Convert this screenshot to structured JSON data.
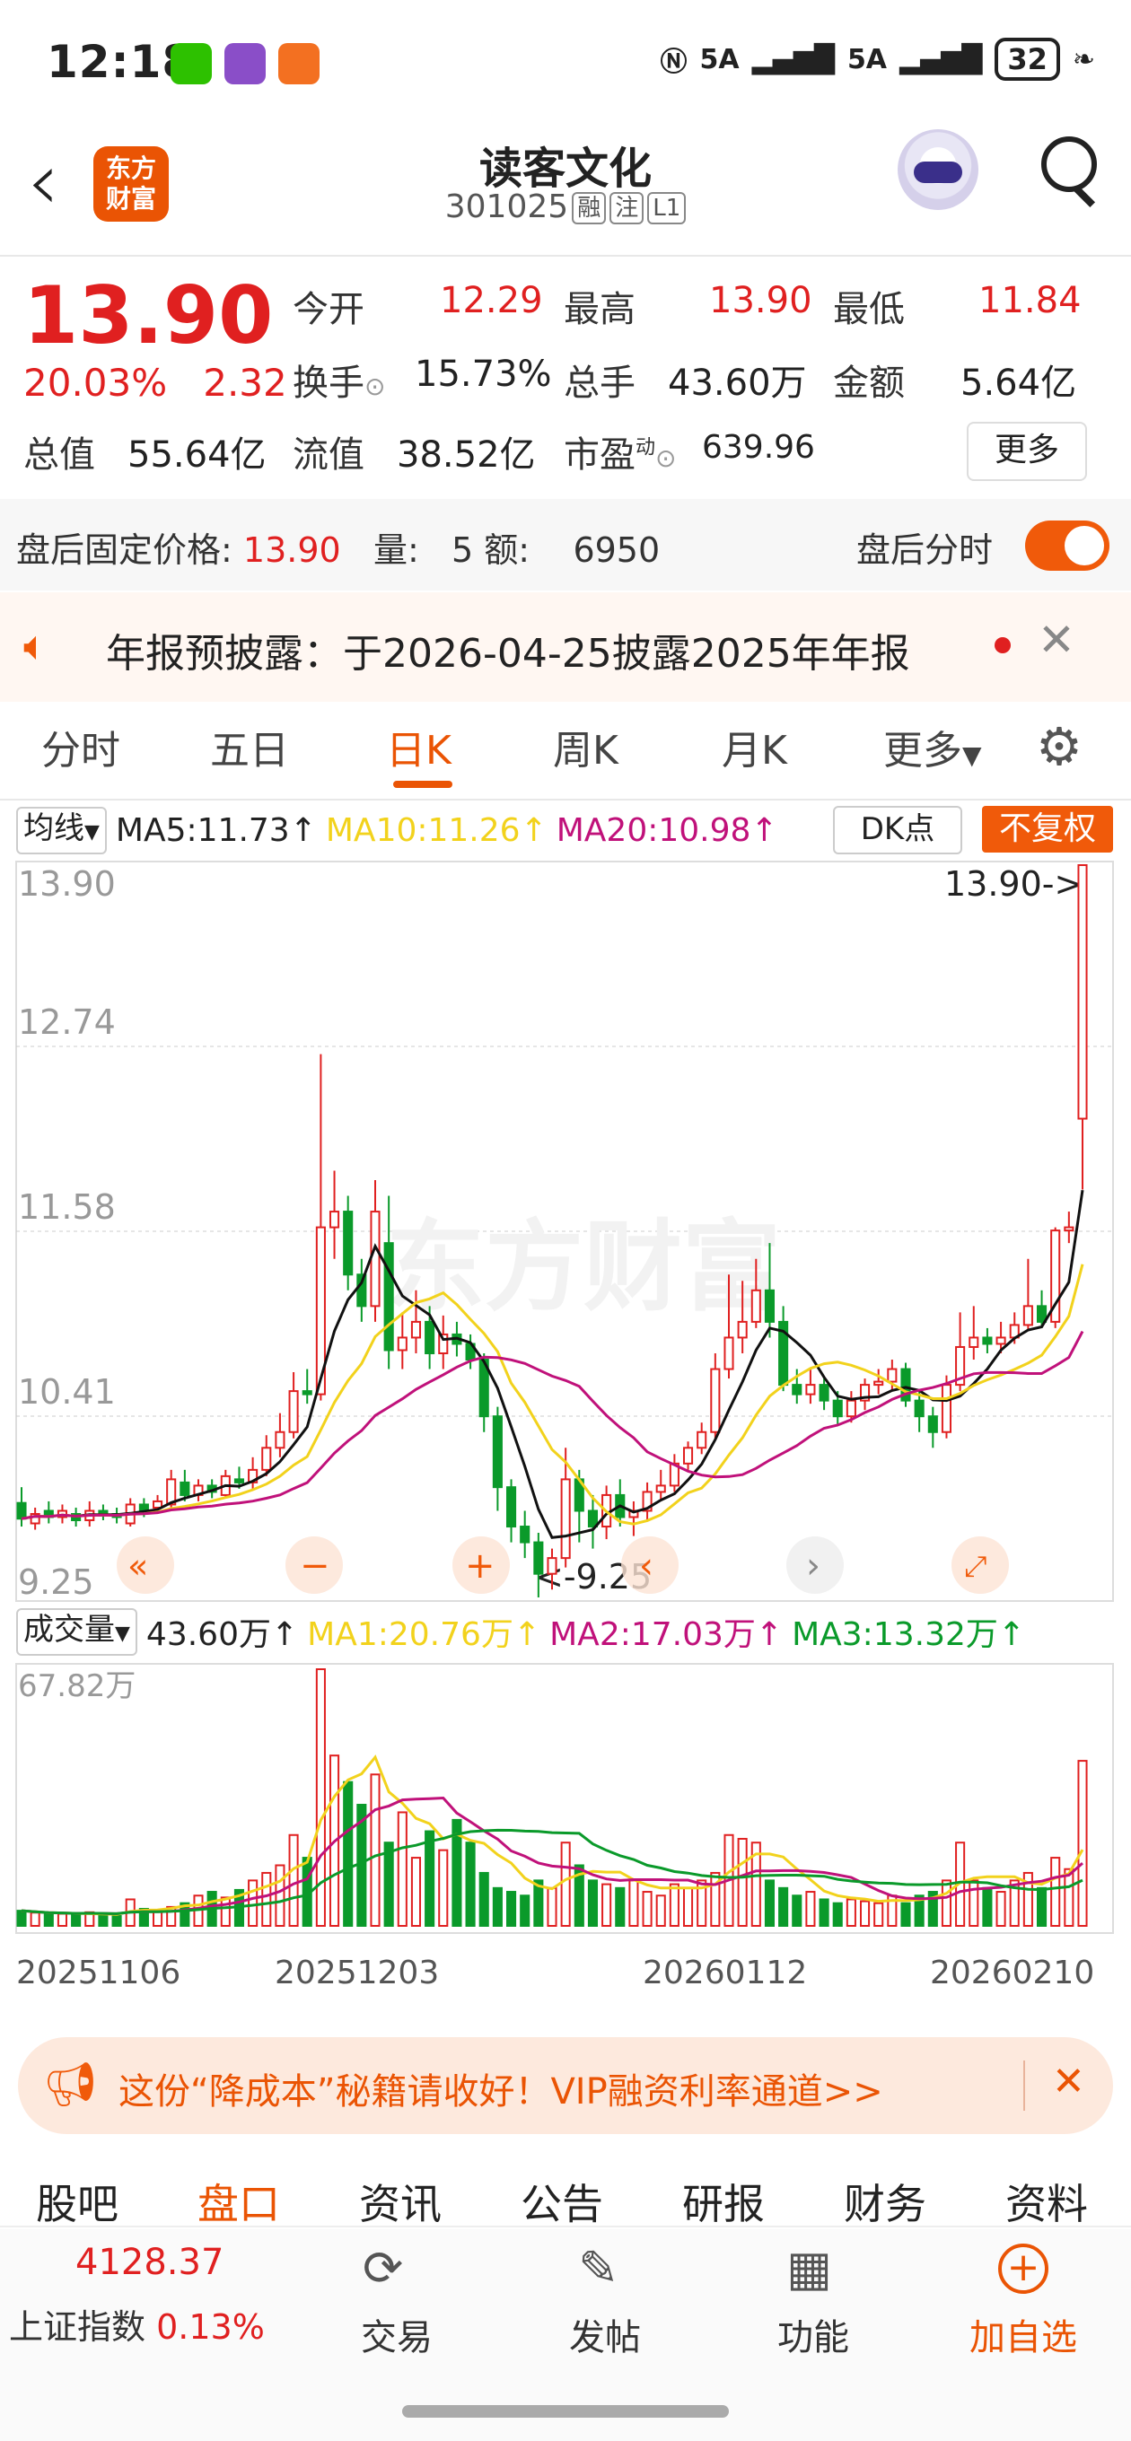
{
  "status_bar": {
    "time": "12:18",
    "battery": "32",
    "signal1": "5A",
    "signal2": "5A"
  },
  "header": {
    "stock_name": "读客文化",
    "stock_code": "301025",
    "tags": [
      "融",
      "注",
      "L1"
    ],
    "logo_text": [
      "东方",
      "财富"
    ]
  },
  "quote": {
    "price": "13.90",
    "change_pct": "20.03%",
    "change_amt": "2.32",
    "fields": [
      {
        "label": "今开",
        "value": "12.29",
        "color": "red"
      },
      {
        "label": "最高",
        "value": "13.90",
        "color": "red"
      },
      {
        "label": "最低",
        "value": "11.84",
        "color": "red"
      },
      {
        "label": "换手",
        "value": "15.73%",
        "color": "black"
      },
      {
        "label": "总手",
        "value": "43.60万",
        "color": "black"
      },
      {
        "label": "金额",
        "value": "5.64亿",
        "color": "black"
      },
      {
        "label": "总值",
        "value": "55.64亿",
        "color": "black"
      },
      {
        "label": "流值",
        "value": "38.52亿",
        "color": "black"
      },
      {
        "label": "市盈",
        "value": "639.96",
        "color": "black"
      }
    ],
    "pe_sup": "动",
    "more_label": "更多"
  },
  "after_hours": {
    "label": "盘后固定价格:",
    "price": "13.90",
    "vol_label": "量:",
    "vol": "5",
    "amt_label": "额:",
    "amt": "6950",
    "switch_label": "盘后分时",
    "switch_on": true
  },
  "notice": {
    "text": "年报预披露：于2026-04-25披露2025年年报"
  },
  "tabs": [
    "分时",
    "五日",
    "日K",
    "周K",
    "月K",
    "更多"
  ],
  "active_tab": "日K",
  "ma_bar": {
    "selector": "均线",
    "ma5": "MA5:11.73",
    "ma10": "MA10:11.26",
    "ma20": "MA20:10.98",
    "dk_label": "DK点",
    "fuquan_label": "不复权"
  },
  "colors": {
    "up": "#e02020",
    "down": "#0a9a2a",
    "ma5": "#111111",
    "ma10": "#f2d21c",
    "ma20": "#c0117a",
    "accent": "#f05a0a"
  },
  "vol_bar": {
    "selector": "成交量",
    "value": "43.60万",
    "ma1": "MA1:20.76万",
    "ma2": "MA2:17.03万",
    "ma3": "MA3:13.32万"
  },
  "chart_data": {
    "type": "candlestick",
    "y_ticks": [
      "13.90",
      "12.74",
      "11.58",
      "10.41",
      "9.25"
    ],
    "ylim": [
      9.25,
      13.9
    ],
    "max_label": "13.90->",
    "min_label": "<-9.25",
    "vol_max_label": "67.82万",
    "x_labels": [
      "20251106",
      "20251203",
      "20260112",
      "20260210"
    ],
    "watermark": "东方财富",
    "candles": [
      [
        9.85,
        9.75,
        9.95,
        9.7
      ],
      [
        9.72,
        9.78,
        9.82,
        9.68
      ],
      [
        9.8,
        9.76,
        9.86,
        9.72
      ],
      [
        9.76,
        9.8,
        9.84,
        9.72
      ],
      [
        9.78,
        9.74,
        9.82,
        9.7
      ],
      [
        9.74,
        9.8,
        9.86,
        9.7
      ],
      [
        9.8,
        9.78,
        9.84,
        9.74
      ],
      [
        9.78,
        9.76,
        9.82,
        9.72
      ],
      [
        9.72,
        9.84,
        9.88,
        9.7
      ],
      [
        9.84,
        9.8,
        9.88,
        9.76
      ],
      [
        9.82,
        9.86,
        9.9,
        9.78
      ],
      [
        9.84,
        10.0,
        10.06,
        9.82
      ],
      [
        9.98,
        9.9,
        10.06,
        9.86
      ],
      [
        9.9,
        9.96,
        10.0,
        9.86
      ],
      [
        9.96,
        9.92,
        10.0,
        9.88
      ],
      [
        9.9,
        10.02,
        10.06,
        9.88
      ],
      [
        10.0,
        9.98,
        10.08,
        9.94
      ],
      [
        9.98,
        10.06,
        10.14,
        9.94
      ],
      [
        10.06,
        10.2,
        10.28,
        10.02
      ],
      [
        10.2,
        10.3,
        10.42,
        10.14
      ],
      [
        10.3,
        10.56,
        10.68,
        10.26
      ],
      [
        10.56,
        10.54,
        10.7,
        10.48
      ],
      [
        10.54,
        11.6,
        12.7,
        10.5
      ],
      [
        11.6,
        11.7,
        11.96,
        11.4
      ],
      [
        11.7,
        11.3,
        11.8,
        11.2
      ],
      [
        11.3,
        11.1,
        11.4,
        11.0
      ],
      [
        11.1,
        11.7,
        11.9,
        11.0
      ],
      [
        11.5,
        10.82,
        11.8,
        10.7
      ],
      [
        10.82,
        10.9,
        11.06,
        10.7
      ],
      [
        10.9,
        11.0,
        11.2,
        10.8
      ],
      [
        11.0,
        10.8,
        11.1,
        10.7
      ],
      [
        10.8,
        10.92,
        11.04,
        10.7
      ],
      [
        10.92,
        10.86,
        11.0,
        10.78
      ],
      [
        10.86,
        10.76,
        10.92,
        10.7
      ],
      [
        10.76,
        10.4,
        10.8,
        10.3
      ],
      [
        10.4,
        9.95,
        10.46,
        9.8
      ],
      [
        9.95,
        9.7,
        10.0,
        9.6
      ],
      [
        9.7,
        9.6,
        9.8,
        9.5
      ],
      [
        9.6,
        9.4,
        9.66,
        9.25
      ],
      [
        9.4,
        9.5,
        9.56,
        9.3
      ],
      [
        9.5,
        10.0,
        10.2,
        9.44
      ],
      [
        10.0,
        9.8,
        10.06,
        9.6
      ],
      [
        9.8,
        9.7,
        9.9,
        9.56
      ],
      [
        9.7,
        9.9,
        9.96,
        9.62
      ],
      [
        9.9,
        9.76,
        10.0,
        9.7
      ],
      [
        9.76,
        9.8,
        9.86,
        9.64
      ],
      [
        9.8,
        9.92,
        9.98,
        9.74
      ],
      [
        9.92,
        9.96,
        10.06,
        9.86
      ],
      [
        9.96,
        10.1,
        10.16,
        9.92
      ],
      [
        10.1,
        10.2,
        10.24,
        10.06
      ],
      [
        10.2,
        10.3,
        10.36,
        10.16
      ],
      [
        10.3,
        10.7,
        10.8,
        10.26
      ],
      [
        10.7,
        10.9,
        11.3,
        10.64
      ],
      [
        10.9,
        11.0,
        11.26,
        10.8
      ],
      [
        11.0,
        11.2,
        11.4,
        10.96
      ],
      [
        11.2,
        11.0,
        11.5,
        10.9
      ],
      [
        11.0,
        10.6,
        11.1,
        10.56
      ],
      [
        10.6,
        10.54,
        10.7,
        10.48
      ],
      [
        10.54,
        10.6,
        10.7,
        10.48
      ],
      [
        10.6,
        10.5,
        10.64,
        10.44
      ],
      [
        10.5,
        10.4,
        10.56,
        10.34
      ],
      [
        10.4,
        10.5,
        10.56,
        10.36
      ],
      [
        10.5,
        10.6,
        10.64,
        10.44
      ],
      [
        10.6,
        10.62,
        10.7,
        10.54
      ],
      [
        10.62,
        10.7,
        10.76,
        10.56
      ],
      [
        10.7,
        10.5,
        10.74,
        10.46
      ],
      [
        10.5,
        10.4,
        10.56,
        10.3
      ],
      [
        10.4,
        10.3,
        10.46,
        10.2
      ],
      [
        10.3,
        10.6,
        10.66,
        10.26
      ],
      [
        10.6,
        10.84,
        11.06,
        10.56
      ],
      [
        10.84,
        10.9,
        11.1,
        10.76
      ],
      [
        10.9,
        10.86,
        10.96,
        10.8
      ],
      [
        10.86,
        10.9,
        11.0,
        10.8
      ],
      [
        10.9,
        10.98,
        11.06,
        10.86
      ],
      [
        10.98,
        11.1,
        11.4,
        10.94
      ],
      [
        11.1,
        11.0,
        11.2,
        10.96
      ],
      [
        11.0,
        11.58,
        11.6,
        10.96
      ],
      [
        11.58,
        11.6,
        11.7,
        11.5
      ],
      [
        12.29,
        13.9,
        13.9,
        11.84
      ]
    ],
    "volumes": [
      4.0,
      3.5,
      3.0,
      3.2,
      2.8,
      3.6,
      3.0,
      2.6,
      7.0,
      4.5,
      4.0,
      5.0,
      6.0,
      8.0,
      9.0,
      7.5,
      9.5,
      12.0,
      14.0,
      16.0,
      24.0,
      18.0,
      67.8,
      45.0,
      38.0,
      32.0,
      40.0,
      22.0,
      30.0,
      18.0,
      25.0,
      20.0,
      28.0,
      22.0,
      14.0,
      10.0,
      9.0,
      8.0,
      12.0,
      10.0,
      22.0,
      16.0,
      12.0,
      11.0,
      10.0,
      12.0,
      9.0,
      8.0,
      11.0,
      10.0,
      12.0,
      14.0,
      24.0,
      23.0,
      22.0,
      12.0,
      10.0,
      8.0,
      9.0,
      7.0,
      6.0,
      7.0,
      6.5,
      6.0,
      8.0,
      6.0,
      8.0,
      9.0,
      12.0,
      22.0,
      12.0,
      10.0,
      9.0,
      12.0,
      14.0,
      10.0,
      18.0,
      15.0,
      43.6
    ]
  },
  "ad": {
    "text": "这份“降成本”秘籍请收好！VIP融资利率通道>>"
  },
  "bottom_tabs": [
    "股吧",
    "盘口",
    "资讯",
    "公告",
    "研报",
    "财务",
    "资料"
  ],
  "active_bottom_tab": "盘口",
  "footer": {
    "index_value": "4128.37",
    "index_name": "上证指数",
    "index_pct": "0.13%",
    "buttons": [
      "交易",
      "发帖",
      "功能",
      "加自选"
    ]
  }
}
